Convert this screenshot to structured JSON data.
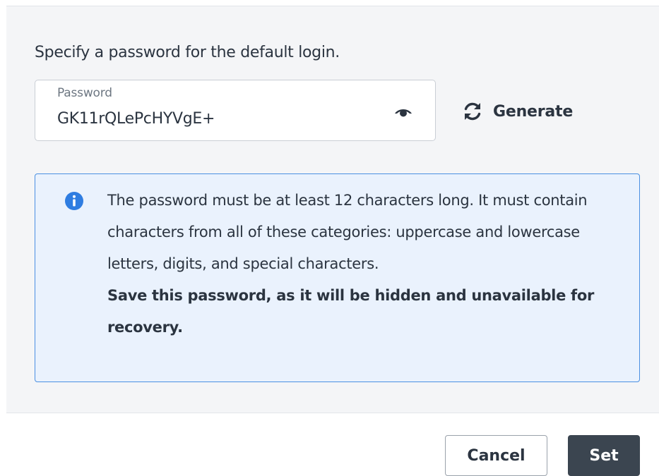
{
  "dialog": {
    "intro_text": "Specify a password for the default login.",
    "password": {
      "label": "Password",
      "value": "GK11rQLePcHYVgE+",
      "visibility_icon": "eye-icon"
    },
    "generate": {
      "label": "Generate",
      "icon": "refresh-icon"
    },
    "info": {
      "icon": "info-icon",
      "text": "The password must be at least 12 characters long. It must contain characters from all of these categories: uppercase and lowercase letters, digits, and special characters.",
      "bold_text": "Save this password, as it will be hidden and unavailable for recovery."
    },
    "buttons": {
      "cancel_label": "Cancel",
      "set_label": "Set"
    }
  },
  "colors": {
    "panel_bg": "#f4f5f7",
    "info_bg": "#eaf2fd",
    "info_border": "#4a90e2",
    "primary_button": "#3b4550",
    "text": "#2b3440"
  }
}
